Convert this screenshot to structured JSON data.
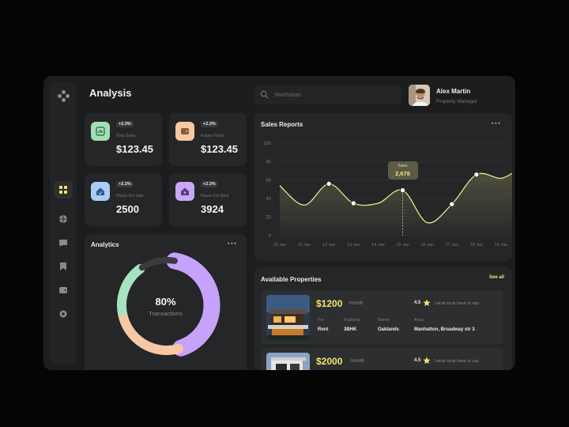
{
  "page": {
    "title": "Analysis"
  },
  "search": {
    "placeholder": "Manhattan"
  },
  "user": {
    "name": "Alex Martin",
    "role": "Property Manager"
  },
  "sidebar": {
    "items": [
      {
        "icon": "grid-icon",
        "active": true
      },
      {
        "icon": "basketball-icon",
        "active": false
      },
      {
        "icon": "chat-icon",
        "active": false
      },
      {
        "icon": "bookmark-icon",
        "active": false
      },
      {
        "icon": "wallet-icon",
        "active": false
      },
      {
        "icon": "settings-icon",
        "active": false
      }
    ]
  },
  "stats": [
    {
      "label": "Total Sales",
      "value": "$123.45",
      "badge": "+2.3%",
      "icon": "chart-icon",
      "color": "#9fe0b5"
    },
    {
      "label": "Future Funds",
      "value": "$123.45",
      "badge": "+2.3%",
      "icon": "wallet-icon",
      "color": "#f7c8a4"
    },
    {
      "label": "House For Sale",
      "value": "2500",
      "badge": "+2.3%",
      "icon": "house-icon",
      "color": "#aacdf5"
    },
    {
      "label": "House For Rent",
      "value": "3924",
      "badge": "+2.3%",
      "icon": "house-icon",
      "color": "#c8a8f5"
    }
  ],
  "analytics": {
    "title": "Analytics",
    "center_value": "80%",
    "center_label": "Transactions",
    "segments": [
      {
        "color": "#c6a2fb",
        "fraction": 0.43
      },
      {
        "color": "#f7c8a4",
        "fraction": 0.27
      },
      {
        "color": "#a6e3bf",
        "fraction": 0.18
      },
      {
        "color": "#3a3b3d",
        "fraction": 0.12
      }
    ]
  },
  "sales_report": {
    "title": "Sales Reports",
    "tooltip_label": "Sales",
    "tooltip_value": "2,678"
  },
  "chart_data": {
    "type": "area",
    "title": "Sales Reports",
    "categories": [
      "10 Jan",
      "11 Jan",
      "12 Jan",
      "13 Jan",
      "14 Jan",
      "15 Jan",
      "16 Jan",
      "17 Jan",
      "18 Jan",
      "19 Jan"
    ],
    "y_ticks": [
      0,
      20,
      40,
      60,
      80,
      100
    ],
    "ylim": [
      0,
      100
    ],
    "points": [
      {
        "x": 0,
        "y": 54
      },
      {
        "x": 1,
        "y": 33
      },
      {
        "x": 2,
        "y": 56
      },
      {
        "x": 3,
        "y": 35
      },
      {
        "x": 4,
        "y": 35
      },
      {
        "x": 5,
        "y": 49
      },
      {
        "x": 6,
        "y": 14
      },
      {
        "x": 7,
        "y": 34
      },
      {
        "x": 8,
        "y": 66
      },
      {
        "x": 9,
        "y": 62
      },
      {
        "x": 9.7,
        "y": 72
      }
    ],
    "markers": [
      2,
      3,
      5,
      7,
      8
    ],
    "highlight_index": 5,
    "line_color": "#e6e58a",
    "grid": true
  },
  "properties": {
    "title": "Available Properties",
    "see_all": "See all",
    "items": [
      {
        "price": "$1200",
        "period": "/month",
        "rating": "4.5",
        "review": "/ what local have to say",
        "headers": [
          "For",
          "Fullness",
          "Name",
          "Area"
        ],
        "values": [
          "Rent",
          "3BHK",
          "Oaklands",
          "Manhatton, Broadway str 3"
        ]
      },
      {
        "price": "$2000",
        "period": "/month",
        "rating": "4.5",
        "review": "/ what local have to say"
      }
    ]
  }
}
